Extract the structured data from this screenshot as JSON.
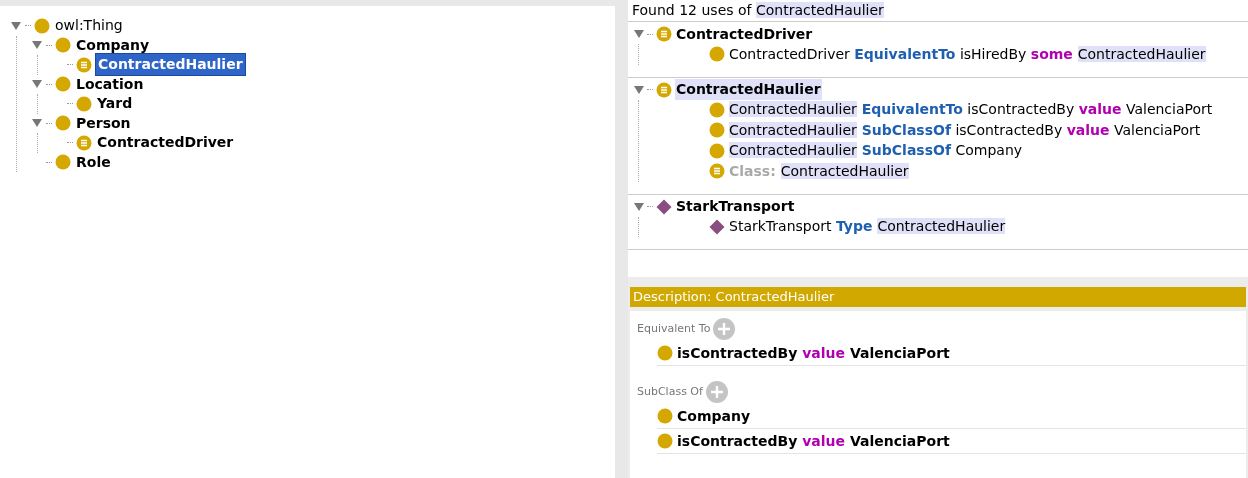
{
  "class_tree": [
    {
      "label": "owl:Thing",
      "kind": "root",
      "selected": false,
      "expanded": true,
      "children": [
        {
          "label": "Company",
          "kind": "class",
          "selected": false,
          "expanded": true,
          "children": [
            {
              "label": "ContractedHaulier",
              "kind": "defined",
              "selected": true
            }
          ]
        },
        {
          "label": "Location",
          "kind": "class",
          "selected": false,
          "expanded": true,
          "children": [
            {
              "label": "Yard",
              "kind": "class",
              "selected": false
            }
          ]
        },
        {
          "label": "Person",
          "kind": "class",
          "selected": false,
          "expanded": true,
          "children": [
            {
              "label": "ContractedDriver",
              "kind": "defined",
              "selected": false
            }
          ]
        },
        {
          "label": "Role",
          "kind": "class",
          "selected": false
        }
      ]
    }
  ],
  "usage": {
    "summary": [
      {
        "text": "Found 12 uses of ",
        "kind": "plain"
      },
      {
        "text": "ContractedHaulier",
        "kind": "highlight"
      }
    ],
    "groups": [
      {
        "name": "ContractedDriver",
        "kind": "defined",
        "highlighted": false,
        "expanded": true,
        "items": [
          {
            "kind": "class",
            "segments": [
              {
                "text": "ContractedDriver ",
                "kind": "plain"
              },
              {
                "text": "EquivalentTo",
                "kind": "keyword"
              },
              {
                "text": " isHiredBy ",
                "kind": "plain"
              },
              {
                "text": "some ",
                "kind": "restriction"
              },
              {
                "text": "ContractedHaulier",
                "kind": "highlight"
              }
            ]
          }
        ]
      },
      {
        "name": "ContractedHaulier",
        "kind": "defined",
        "highlighted": true,
        "expanded": true,
        "items": [
          {
            "kind": "class",
            "segments": [
              {
                "text": "ContractedHaulier",
                "kind": "highlight"
              },
              {
                "text": " EquivalentTo",
                "kind": "keyword"
              },
              {
                "text": " isContractedBy ",
                "kind": "plain"
              },
              {
                "text": "value",
                "kind": "restriction"
              },
              {
                "text": " ValenciaPort",
                "kind": "plain"
              }
            ]
          },
          {
            "kind": "class",
            "segments": [
              {
                "text": "ContractedHaulier",
                "kind": "highlight"
              },
              {
                "text": " SubClassOf",
                "kind": "keyword"
              },
              {
                "text": " isContractedBy ",
                "kind": "plain"
              },
              {
                "text": "value",
                "kind": "restriction"
              },
              {
                "text": " ValenciaPort",
                "kind": "plain"
              }
            ]
          },
          {
            "kind": "class",
            "segments": [
              {
                "text": "ContractedHaulier",
                "kind": "highlight"
              },
              {
                "text": " SubClassOf",
                "kind": "keyword"
              },
              {
                "text": " Company",
                "kind": "plain"
              }
            ]
          },
          {
            "kind": "defined",
            "segments": [
              {
                "text": "Class: ",
                "kind": "label"
              },
              {
                "text": "ContractedHaulier",
                "kind": "highlight"
              }
            ]
          }
        ]
      },
      {
        "name": "StarkTransport",
        "kind": "individual",
        "highlighted": false,
        "expanded": true,
        "items": [
          {
            "kind": "individual",
            "segments": [
              {
                "text": "StarkTransport ",
                "kind": "plain"
              },
              {
                "text": "Type ",
                "kind": "keyword"
              },
              {
                "text": "ContractedHaulier",
                "kind": "highlight"
              }
            ]
          }
        ]
      }
    ]
  },
  "description": {
    "title": "Description: ContractedHaulier",
    "sections": [
      {
        "label": "Equivalent To",
        "items": [
          {
            "kind": "class",
            "segments": [
              {
                "text": "isContractedBy ",
                "kind": "plain"
              },
              {
                "text": "value",
                "kind": "restriction"
              },
              {
                "text": " ValenciaPort",
                "kind": "plain"
              }
            ]
          }
        ]
      },
      {
        "label": "SubClass Of",
        "items": [
          {
            "kind": "class",
            "segments": [
              {
                "text": "Company",
                "kind": "plain"
              }
            ]
          },
          {
            "kind": "class",
            "segments": [
              {
                "text": "isContractedBy ",
                "kind": "plain"
              },
              {
                "text": "value",
                "kind": "restriction"
              },
              {
                "text": " ValenciaPort",
                "kind": "plain"
              }
            ]
          }
        ]
      }
    ]
  }
}
